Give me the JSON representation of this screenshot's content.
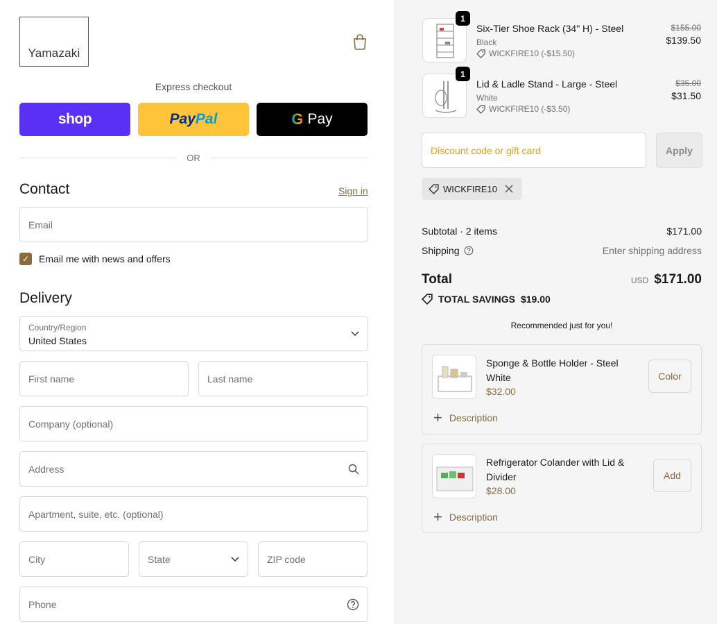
{
  "brand": {
    "name": "Yamazaki"
  },
  "express": {
    "label": "Express checkout",
    "shop": "shop",
    "paypal_a": "Pay",
    "paypal_b": "Pal",
    "gpay_g": "G",
    "gpay": "Pay",
    "or": "OR"
  },
  "contact": {
    "heading": "Contact",
    "sign_in": "Sign in",
    "email_placeholder": "Email",
    "newsletter_label": "Email me with news and offers",
    "newsletter_checked": true
  },
  "delivery": {
    "heading": "Delivery",
    "country_label": "Country/Region",
    "country_value": "United States",
    "first_name": "First name",
    "last_name": "Last name",
    "company": "Company (optional)",
    "address": "Address",
    "apartment": "Apartment, suite, etc. (optional)",
    "city": "City",
    "state": "State",
    "zip": "ZIP code",
    "phone": "Phone"
  },
  "cart": {
    "items": [
      {
        "qty": "1",
        "title": "Six-Tier Shoe Rack (34\" H) - Steel",
        "variant": "Black",
        "discount": "WICKFIRE10 (-$15.50)",
        "price_old": "$155.00",
        "price_new": "$139.50"
      },
      {
        "qty": "1",
        "title": "Lid & Ladle Stand - Large - Steel",
        "variant": "White",
        "discount": "WICKFIRE10 (-$3.50)",
        "price_old": "$35.00",
        "price_new": "$31.50"
      }
    ],
    "discount_placeholder": "Discount code or gift card",
    "apply": "Apply",
    "applied_code": "WICKFIRE10"
  },
  "summary": {
    "subtotal_label": "Subtotal · 2 items",
    "subtotal_value": "$171.00",
    "shipping_label": "Shipping",
    "shipping_value": "Enter shipping address",
    "total_label": "Total",
    "currency": "USD",
    "total_value": "$171.00",
    "savings_label": "TOTAL SAVINGS",
    "savings_value": "$19.00"
  },
  "recommendations": {
    "title": "Recommended just for you!",
    "items": [
      {
        "name_line1": "Sponge & Bottle Holder - Steel",
        "name_line2": "White",
        "price": "$32.00",
        "button": "Color",
        "description": "Description"
      },
      {
        "name_line1": "Refrigerator Colander with Lid &",
        "name_line2": "Divider",
        "price": "$28.00",
        "button": "Add",
        "description": "Description"
      }
    ]
  },
  "colors": {
    "accent": "#8a6a3f",
    "shop": "#5a31f4",
    "paypal": "#ffc439",
    "gpay": "#000000"
  }
}
